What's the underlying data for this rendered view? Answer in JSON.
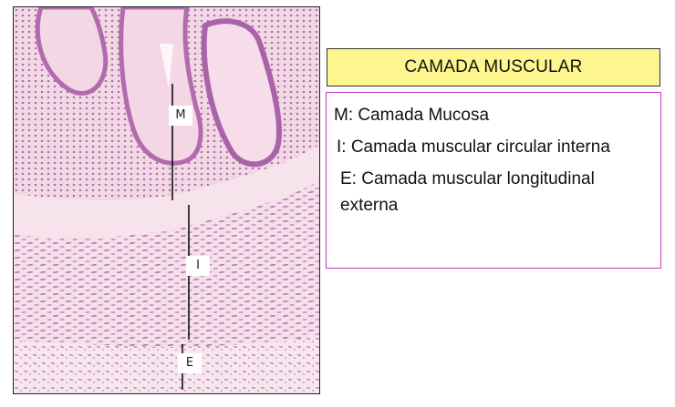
{
  "title": "CAMADA MUSCULAR",
  "markers": {
    "m": "M",
    "i": "I",
    "e": "E"
  },
  "legend": [
    "M: Camada Mucosa",
    "I: Camada muscular circular interna",
    "E: Camada muscular longitudinal externa"
  ],
  "colors": {
    "title_bg": "#fdf58e",
    "legend_border": "#c13bbd",
    "tissue_pink": "#f1dbe4",
    "nuclei": "#8a4f9a"
  }
}
